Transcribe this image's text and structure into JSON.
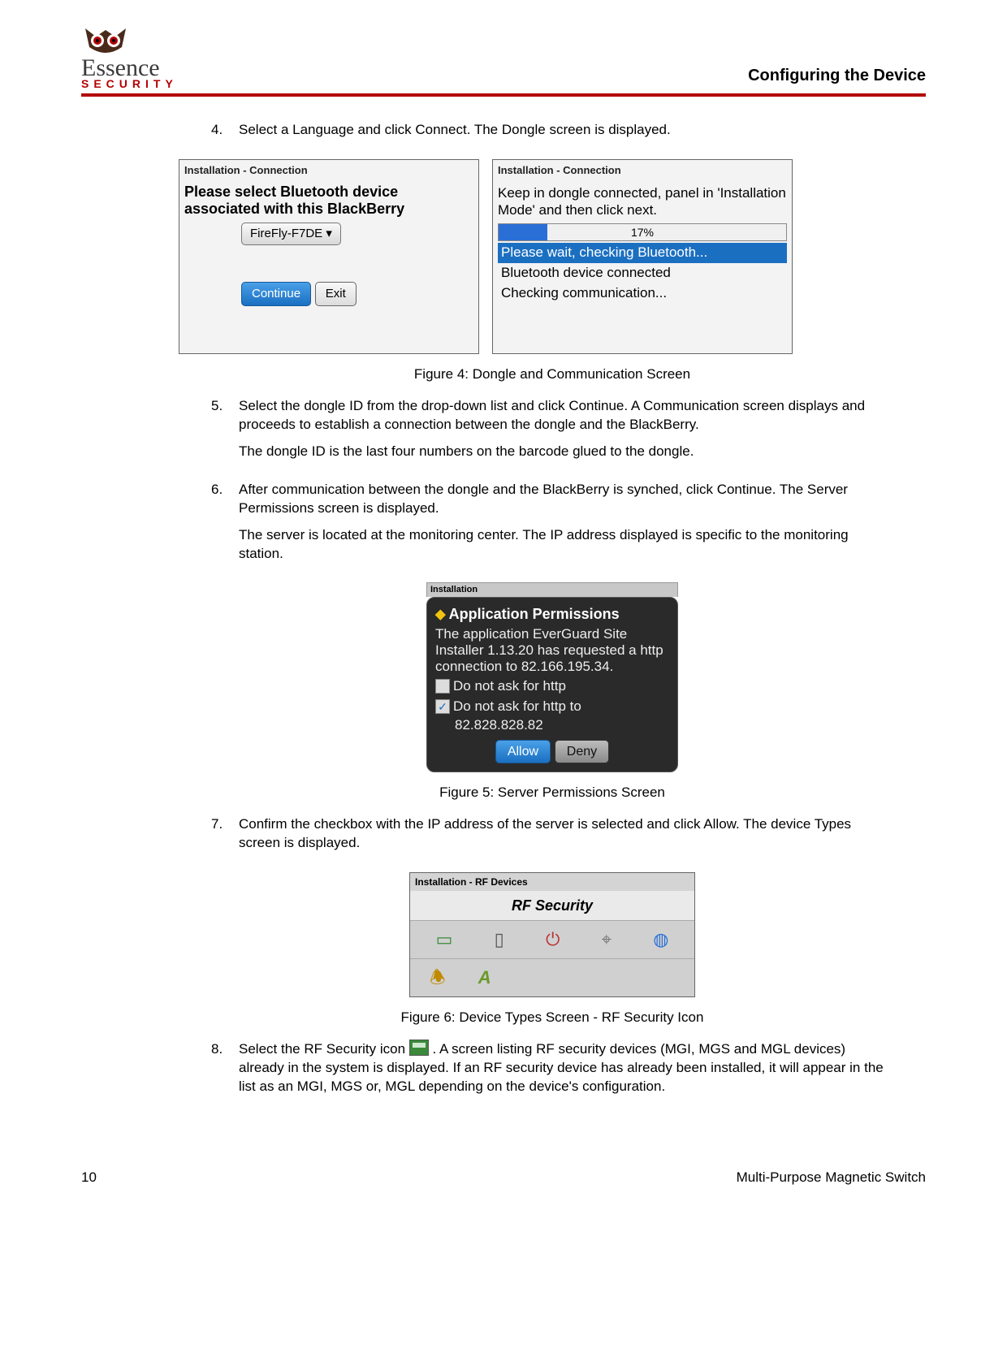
{
  "header": {
    "brand_main": "Essence",
    "brand_sub": "SECURITY",
    "page_title": "Configuring the Device"
  },
  "steps": {
    "s4": {
      "num": "4.",
      "text": "Select a Language and click Connect. The Dongle screen is displayed."
    },
    "s5": {
      "num": "5.",
      "p1": "Select the dongle ID from the drop-down list and click Continue. A Communication screen displays and proceeds to establish a connection between the dongle and the BlackBerry.",
      "p2": "The dongle ID is the last four numbers on the barcode glued to the dongle."
    },
    "s6": {
      "num": "6.",
      "p1": "After communication between the dongle and the BlackBerry is synched, click Continue. The Server Permissions screen is displayed.",
      "p2": "The server is located at the monitoring center. The IP address displayed is specific to the monitoring station."
    },
    "s7": {
      "num": "7.",
      "p1": "Confirm the checkbox with the IP address of the server is selected and click Allow. The device Types screen is displayed."
    },
    "s8": {
      "num": "8.",
      "pre": "Select the RF Security icon ",
      "post": ". A screen listing RF security devices (MGI, MGS and MGL devices) already in the system is displayed. If an RF security device has already been installed, it will appear in the list as an MGI, MGS or, MGL depending on the device's configuration."
    }
  },
  "captions": {
    "fig4": "Figure 4: Dongle and Communication Screen",
    "fig5": "Figure 5: Server Permissions Screen",
    "fig6": "Figure 6: Device Types Screen - RF Security Icon"
  },
  "bb_left": {
    "title": "Installation - Connection",
    "prompt": "Please select Bluetooth device associated with this BlackBerry",
    "dropdown": "FireFly-F7DE ▾",
    "btn_continue": "Continue",
    "btn_exit": "Exit"
  },
  "bb_right": {
    "title": "Installation - Connection",
    "msg": "Keep in dongle connected, panel in 'Installation Mode' and then click next.",
    "progress_label": "17%",
    "status1": "Please wait, checking Bluetooth...",
    "status2": "Bluetooth device connected",
    "status3": "Checking communication..."
  },
  "perm": {
    "bar": "Installation",
    "title": "Application Permissions",
    "body": "The application EverGuard Site Installer 1.13.20 has requested a http connection to 82.166.195.34.",
    "chk1": "Do not ask for http",
    "chk2": "Do not ask for http to",
    "chk2_ip": "82.828.828.82",
    "btn_allow": "Allow",
    "btn_deny": "Deny"
  },
  "rf": {
    "title": "Installation - RF Devices",
    "heading": "RF Security"
  },
  "footer": {
    "page_num": "10",
    "doc_title": "Multi-Purpose Magnetic Switch"
  }
}
